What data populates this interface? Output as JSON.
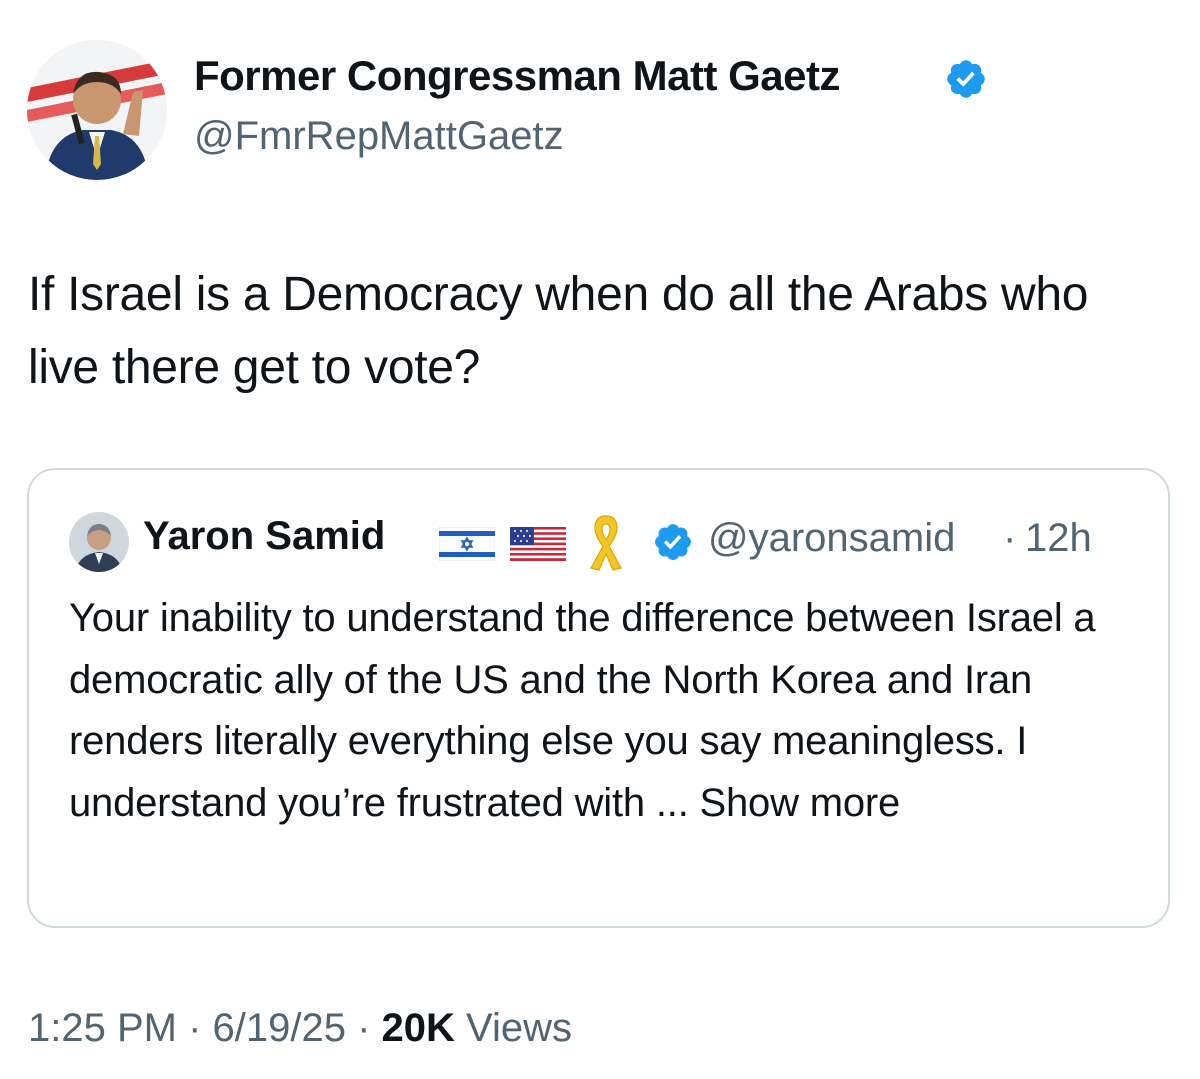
{
  "author": {
    "display_name": "Former Congressman Matt Gaetz",
    "handle": "@FmrRepMattGaetz",
    "verified": true
  },
  "tweet": {
    "text": "If Israel is a Democracy when do all the Arabs who live there get to vote?"
  },
  "quoted_tweet": {
    "display_name": "Yaron Samid",
    "name_emojis": [
      "israel-flag-icon",
      "us-flag-icon",
      "yellow-ribbon-icon"
    ],
    "verified": true,
    "handle": "@yaronsamid",
    "separator": "·",
    "time": "12h",
    "text": "Your inability to understand the difference between Israel a democratic ally of the US and the North Korea and Iran renders literally everything else you say meaningless. I understand you’re frustrated with",
    "ellipsis": " ... ",
    "show_more_label": "Show more"
  },
  "meta": {
    "time": "1:25 PM",
    "sep1": " · ",
    "date": "6/19/25",
    "sep2": " · ",
    "views_count": "20K",
    "views_label": " Views"
  },
  "colors": {
    "text_primary": "#0f1419",
    "text_secondary": "#536471",
    "verified_blue": "#1d9bf0",
    "border": "#cfd9de"
  }
}
